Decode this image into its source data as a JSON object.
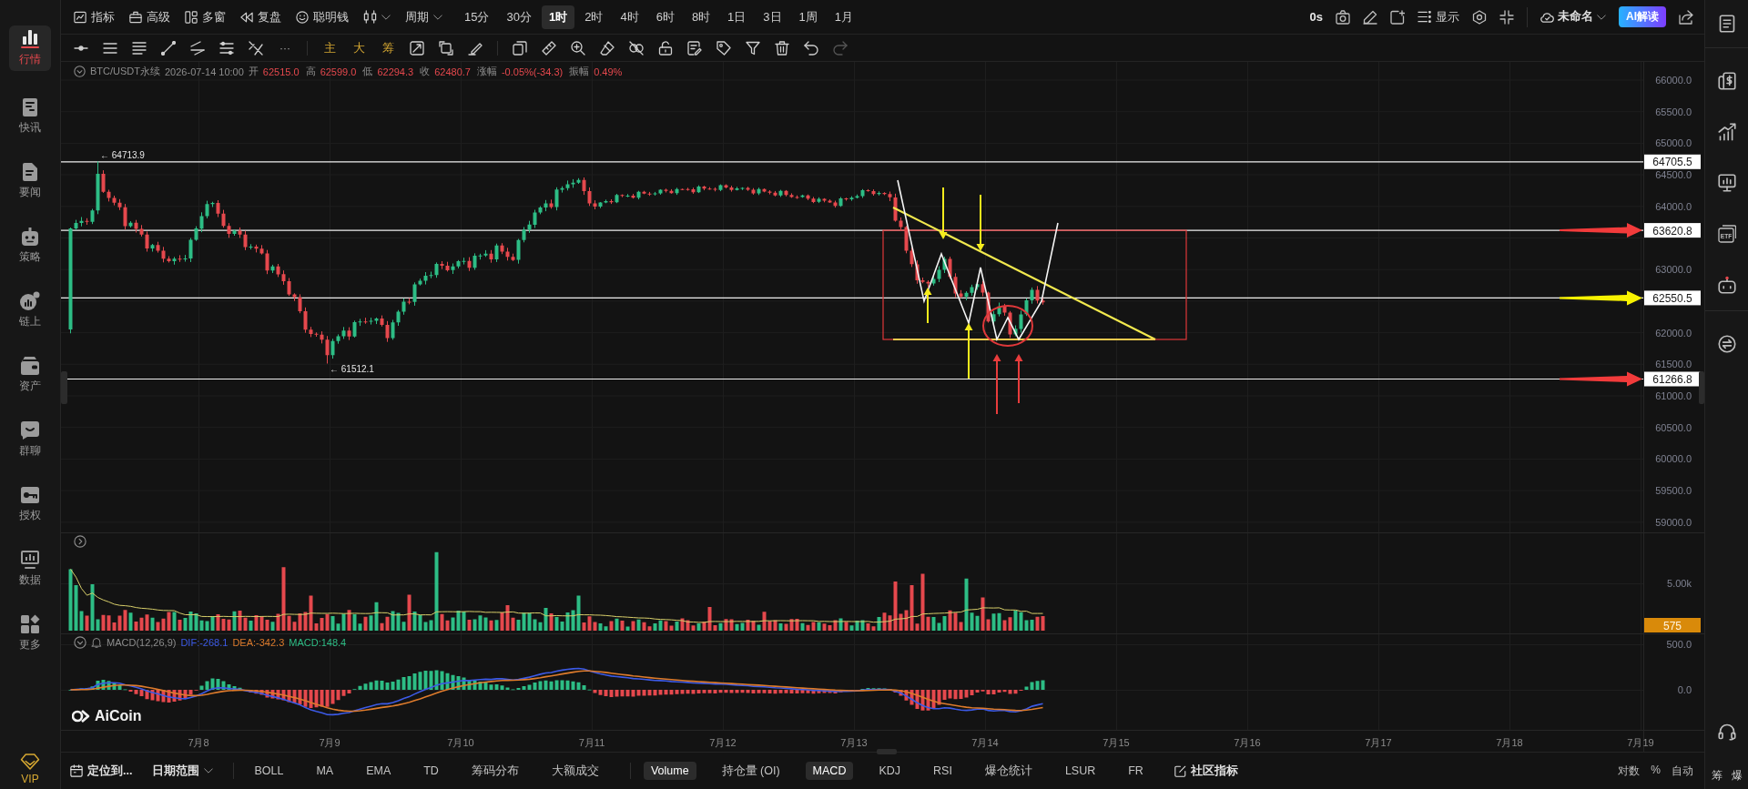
{
  "sidebar": {
    "items": [
      {
        "label": "行情",
        "selected": true,
        "kind": "nav"
      },
      {
        "label": "快讯",
        "selected": false,
        "kind": "nav"
      },
      {
        "label": "要闻",
        "selected": false,
        "kind": "nav"
      },
      {
        "label": "策略",
        "selected": false,
        "kind": "nav"
      },
      {
        "label": "链上",
        "selected": false,
        "kind": "nav"
      },
      {
        "label": "资产",
        "selected": false,
        "kind": "nav"
      },
      {
        "label": "群聊",
        "selected": false,
        "kind": "nav"
      },
      {
        "label": "授权",
        "selected": false,
        "kind": "nav"
      },
      {
        "label": "数据",
        "selected": false,
        "kind": "nav"
      },
      {
        "label": "更多",
        "selected": false,
        "kind": "nav"
      },
      {
        "label": "VIP",
        "selected": false,
        "kind": "vip"
      }
    ]
  },
  "toolbar": {
    "tools": [
      "指标",
      "高级",
      "多窗",
      "复盘",
      "聪明钱"
    ],
    "period_label": "周期",
    "periods": [
      {
        "label": "15分",
        "selected": false
      },
      {
        "label": "30分",
        "selected": false
      },
      {
        "label": "1时",
        "selected": true
      },
      {
        "label": "2时",
        "selected": false
      },
      {
        "label": "4时",
        "selected": false
      },
      {
        "label": "6时",
        "selected": false
      },
      {
        "label": "8时",
        "selected": false
      },
      {
        "label": "1日",
        "selected": false
      },
      {
        "label": "3日",
        "selected": false
      },
      {
        "label": "1周",
        "selected": false
      },
      {
        "label": "1月",
        "selected": false
      }
    ],
    "countdown": "0s",
    "display_label": "显示",
    "layout_name": "未命名",
    "ai_button": "AI解读"
  },
  "drawing_toolbar": {
    "more": "···",
    "overlays": [
      "主",
      "大",
      "筹"
    ],
    "redo_disabled": true
  },
  "info": {
    "symbol": "BTC/USDT永续",
    "time": "2026-07-14 10:00",
    "fields": [
      {
        "label": "开",
        "value": "62515.0"
      },
      {
        "label": "高",
        "value": "62599.0"
      },
      {
        "label": "低",
        "value": "62294.3"
      },
      {
        "label": "收",
        "value": "62480.7"
      },
      {
        "label": "涨幅",
        "value": "-0.05%(-34.3)"
      },
      {
        "label": "振幅",
        "value": "0.49%"
      }
    ]
  },
  "chart": {
    "price_labels": [
      "66000.0",
      "65500.0",
      "65000.0",
      "64500.0",
      "64000.0",
      "63000.0",
      "62000.0",
      "61500.0",
      "61000.0",
      "60500.0",
      "60000.0",
      "59500.0",
      "59000.0"
    ],
    "high_label": "← 64713.9",
    "low_label": "← 61512.1",
    "levels": [
      {
        "price": "64705.5",
        "arrow": false
      },
      {
        "price": "63620.8",
        "arrow": true,
        "color": "#f23b3b"
      },
      {
        "price": "62550.5",
        "arrow": true,
        "color": "#f7f200"
      },
      {
        "price": "61266.8",
        "arrow": true,
        "color": "#f23b3b"
      }
    ],
    "dates": [
      "7月8",
      "7月9",
      "7月10",
      "7月11",
      "7月12",
      "7月13",
      "7月14",
      "7月15",
      "7月16",
      "7月17",
      "7月18",
      "7月19"
    ],
    "logo": "AiCoin"
  },
  "volume": {
    "axis_label": "5.00k",
    "last": "575"
  },
  "macd": {
    "title": "MACD(12,26,9)",
    "dif": "DIF:-268.1",
    "dea": "DEA:-342.3",
    "value": "MACD:148.4",
    "axis_labels": [
      "500.0",
      "0.0"
    ]
  },
  "bottom_bar": {
    "locate": "定位到...",
    "date_range": "日期范围",
    "overlays": [
      {
        "label": "BOLL",
        "selected": false
      },
      {
        "label": "MA",
        "selected": false
      },
      {
        "label": "EMA",
        "selected": false
      },
      {
        "label": "TD",
        "selected": false
      },
      {
        "label": "筹码分布",
        "selected": false
      },
      {
        "label": "大额成交",
        "selected": false
      }
    ],
    "panes": [
      {
        "label": "Volume",
        "selected": true
      },
      {
        "label": "持仓量 (OI)",
        "selected": false
      },
      {
        "label": "MACD",
        "selected": true
      },
      {
        "label": "KDJ",
        "selected": false
      },
      {
        "label": "RSI",
        "selected": false
      },
      {
        "label": "爆仓统计",
        "selected": false
      },
      {
        "label": "LSUR",
        "selected": false
      },
      {
        "label": "FR",
        "selected": false
      }
    ],
    "community": "社区指标",
    "scale_options": [
      "对数",
      "%",
      "自动"
    ]
  },
  "right_sidebar": {
    "etf_label": "ETF",
    "labels": [
      "筹",
      "爆"
    ]
  }
}
